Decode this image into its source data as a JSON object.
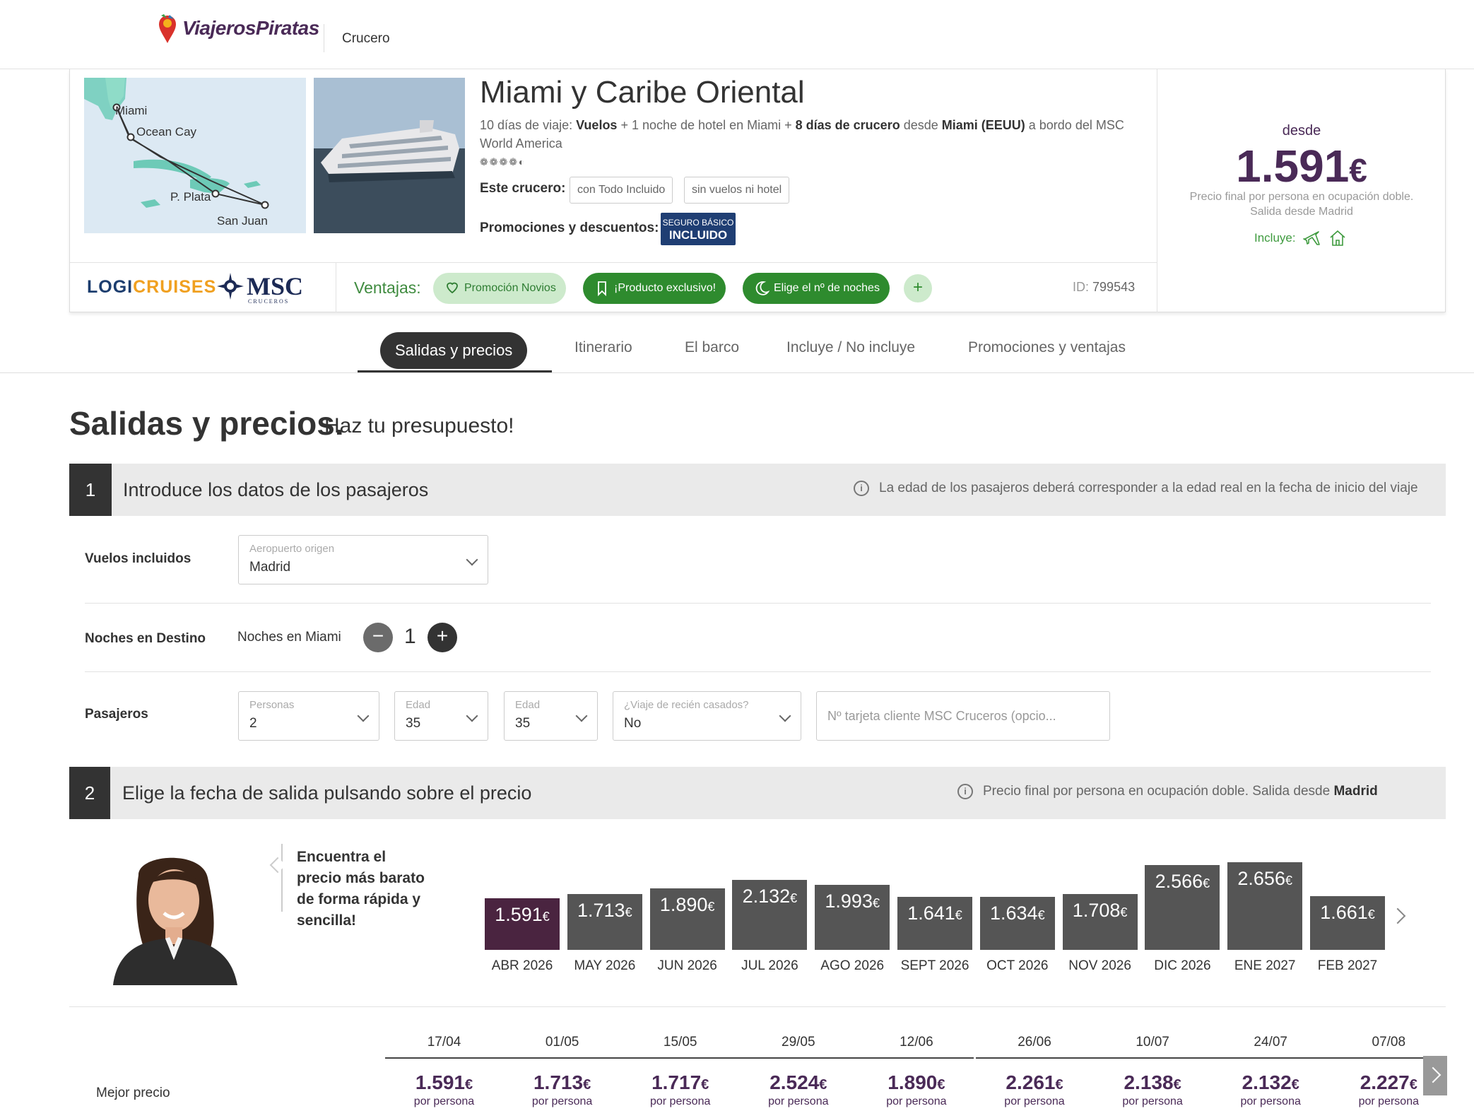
{
  "header": {
    "logo": "ViajerosPiratas",
    "crumb": "Crucero"
  },
  "product": {
    "title": "Miami y Caribe Oriental",
    "desc": {
      "p1": "10 días de viaje: ",
      "b1": "Vuelos",
      "p2": " + 1 noche de hotel en Miami + ",
      "b2": "8 días de crucero",
      "p3": " desde ",
      "b3": "Miami (EEUU)",
      "p4": " a bordo del MSC World America"
    },
    "rating_stars": "❁❁❁❁◐",
    "map_labels": [
      "Miami",
      "Ocean Cay",
      "P. Plata",
      "San Juan"
    ],
    "este_label": "Este crucero:",
    "tags": [
      "con Todo Incluido",
      "sin vuelos ni hotel"
    ],
    "promo_label": "Promociones y descuentos:",
    "seguro": {
      "line1": "SEGURO BÁSICO",
      "line2": "INCLUIDO"
    },
    "brand1_a": "LOGI",
    "brand1_b": "CRUISES",
    "brand2": "MSC",
    "brand2_sub": "CRUCEROS",
    "ventajas_label": "Ventajas:",
    "pills": [
      "Promoción Novios",
      "¡Producto exclusivo!",
      "Elige el nº de noches"
    ],
    "plus": "+",
    "id_label": "ID:",
    "id_value": "799543"
  },
  "price_box": {
    "desde": "desde",
    "amount": "1.591",
    "currency": "€",
    "note1": "Precio final por persona en ocupación doble.",
    "note2": "Salida desde Madrid",
    "incluye": "Incluye:"
  },
  "tabs": [
    "Salidas y precios",
    "Itinerario",
    "El barco",
    "Incluye / No incluye",
    "Promociones y ventajas"
  ],
  "section": {
    "title": "Salidas y precios.",
    "subtitle": "Haz tu presupuesto!"
  },
  "step1": {
    "num": "1",
    "title": "Introduce los datos de los pasajeros",
    "info": "La edad de los pasajeros deberá corresponder a la edad real en la fecha de inicio del viaje",
    "vuelos_label": "Vuelos incluidos",
    "airport": {
      "label": "Aeropuerto origen",
      "value": "Madrid"
    },
    "noches_label": "Noches en Destino",
    "noches_sub": "Noches en Miami",
    "noches_value": "1",
    "pasajeros_label": "Pasajeros",
    "personas": {
      "label": "Personas",
      "value": "2"
    },
    "edad1": {
      "label": "Edad",
      "value": "35"
    },
    "edad2": {
      "label": "Edad",
      "value": "35"
    },
    "recien": {
      "label": "¿Viaje de recién casados?",
      "value": "No"
    },
    "tarjeta_placeholder": "Nº tarjeta cliente MSC Cruceros (opcio..."
  },
  "step2": {
    "num": "2",
    "title": "Elige la fecha de salida pulsando sobre el precio",
    "info": "Precio final por persona en ocupación doble. Salida desde ",
    "info_bold": "Madrid"
  },
  "bubble_text": "Encuentra el precio más barato de forma rápida y sencilla!",
  "chart_data": {
    "type": "bar",
    "categories": [
      "ABR 2026",
      "MAY 2026",
      "JUN 2026",
      "JUL 2026",
      "AGO 2026",
      "SEPT 2026",
      "OCT 2026",
      "NOV 2026",
      "DIC 2026",
      "ENE 2027",
      "FEB 2027"
    ],
    "labels": [
      "1.591",
      "1.713",
      "1.890",
      "2.132",
      "1.993",
      "1.641",
      "1.634",
      "1.708",
      "2.566",
      "2.656",
      "1.661"
    ],
    "values": [
      1591,
      1713,
      1890,
      2132,
      1993,
      1641,
      1634,
      1708,
      2566,
      2656,
      1661
    ],
    "currency": "€",
    "selected_index": 0,
    "colors": {
      "selected": "#4a2440",
      "default": "#555555"
    }
  },
  "departures": {
    "row_label": "Mejor precio",
    "per": "por persona",
    "currency": "€",
    "dates": [
      "17/04",
      "01/05",
      "15/05",
      "29/05",
      "12/06",
      "26/06",
      "10/07",
      "24/07",
      "07/08"
    ],
    "prices": [
      "1.591",
      "1.713",
      "1.717",
      "2.524",
      "1.890",
      "2.261",
      "2.138",
      "2.132",
      "2.227"
    ]
  },
  "colors": {
    "brand": "#4a2a57",
    "green": "#2e8b2e",
    "dark": "#333333"
  }
}
